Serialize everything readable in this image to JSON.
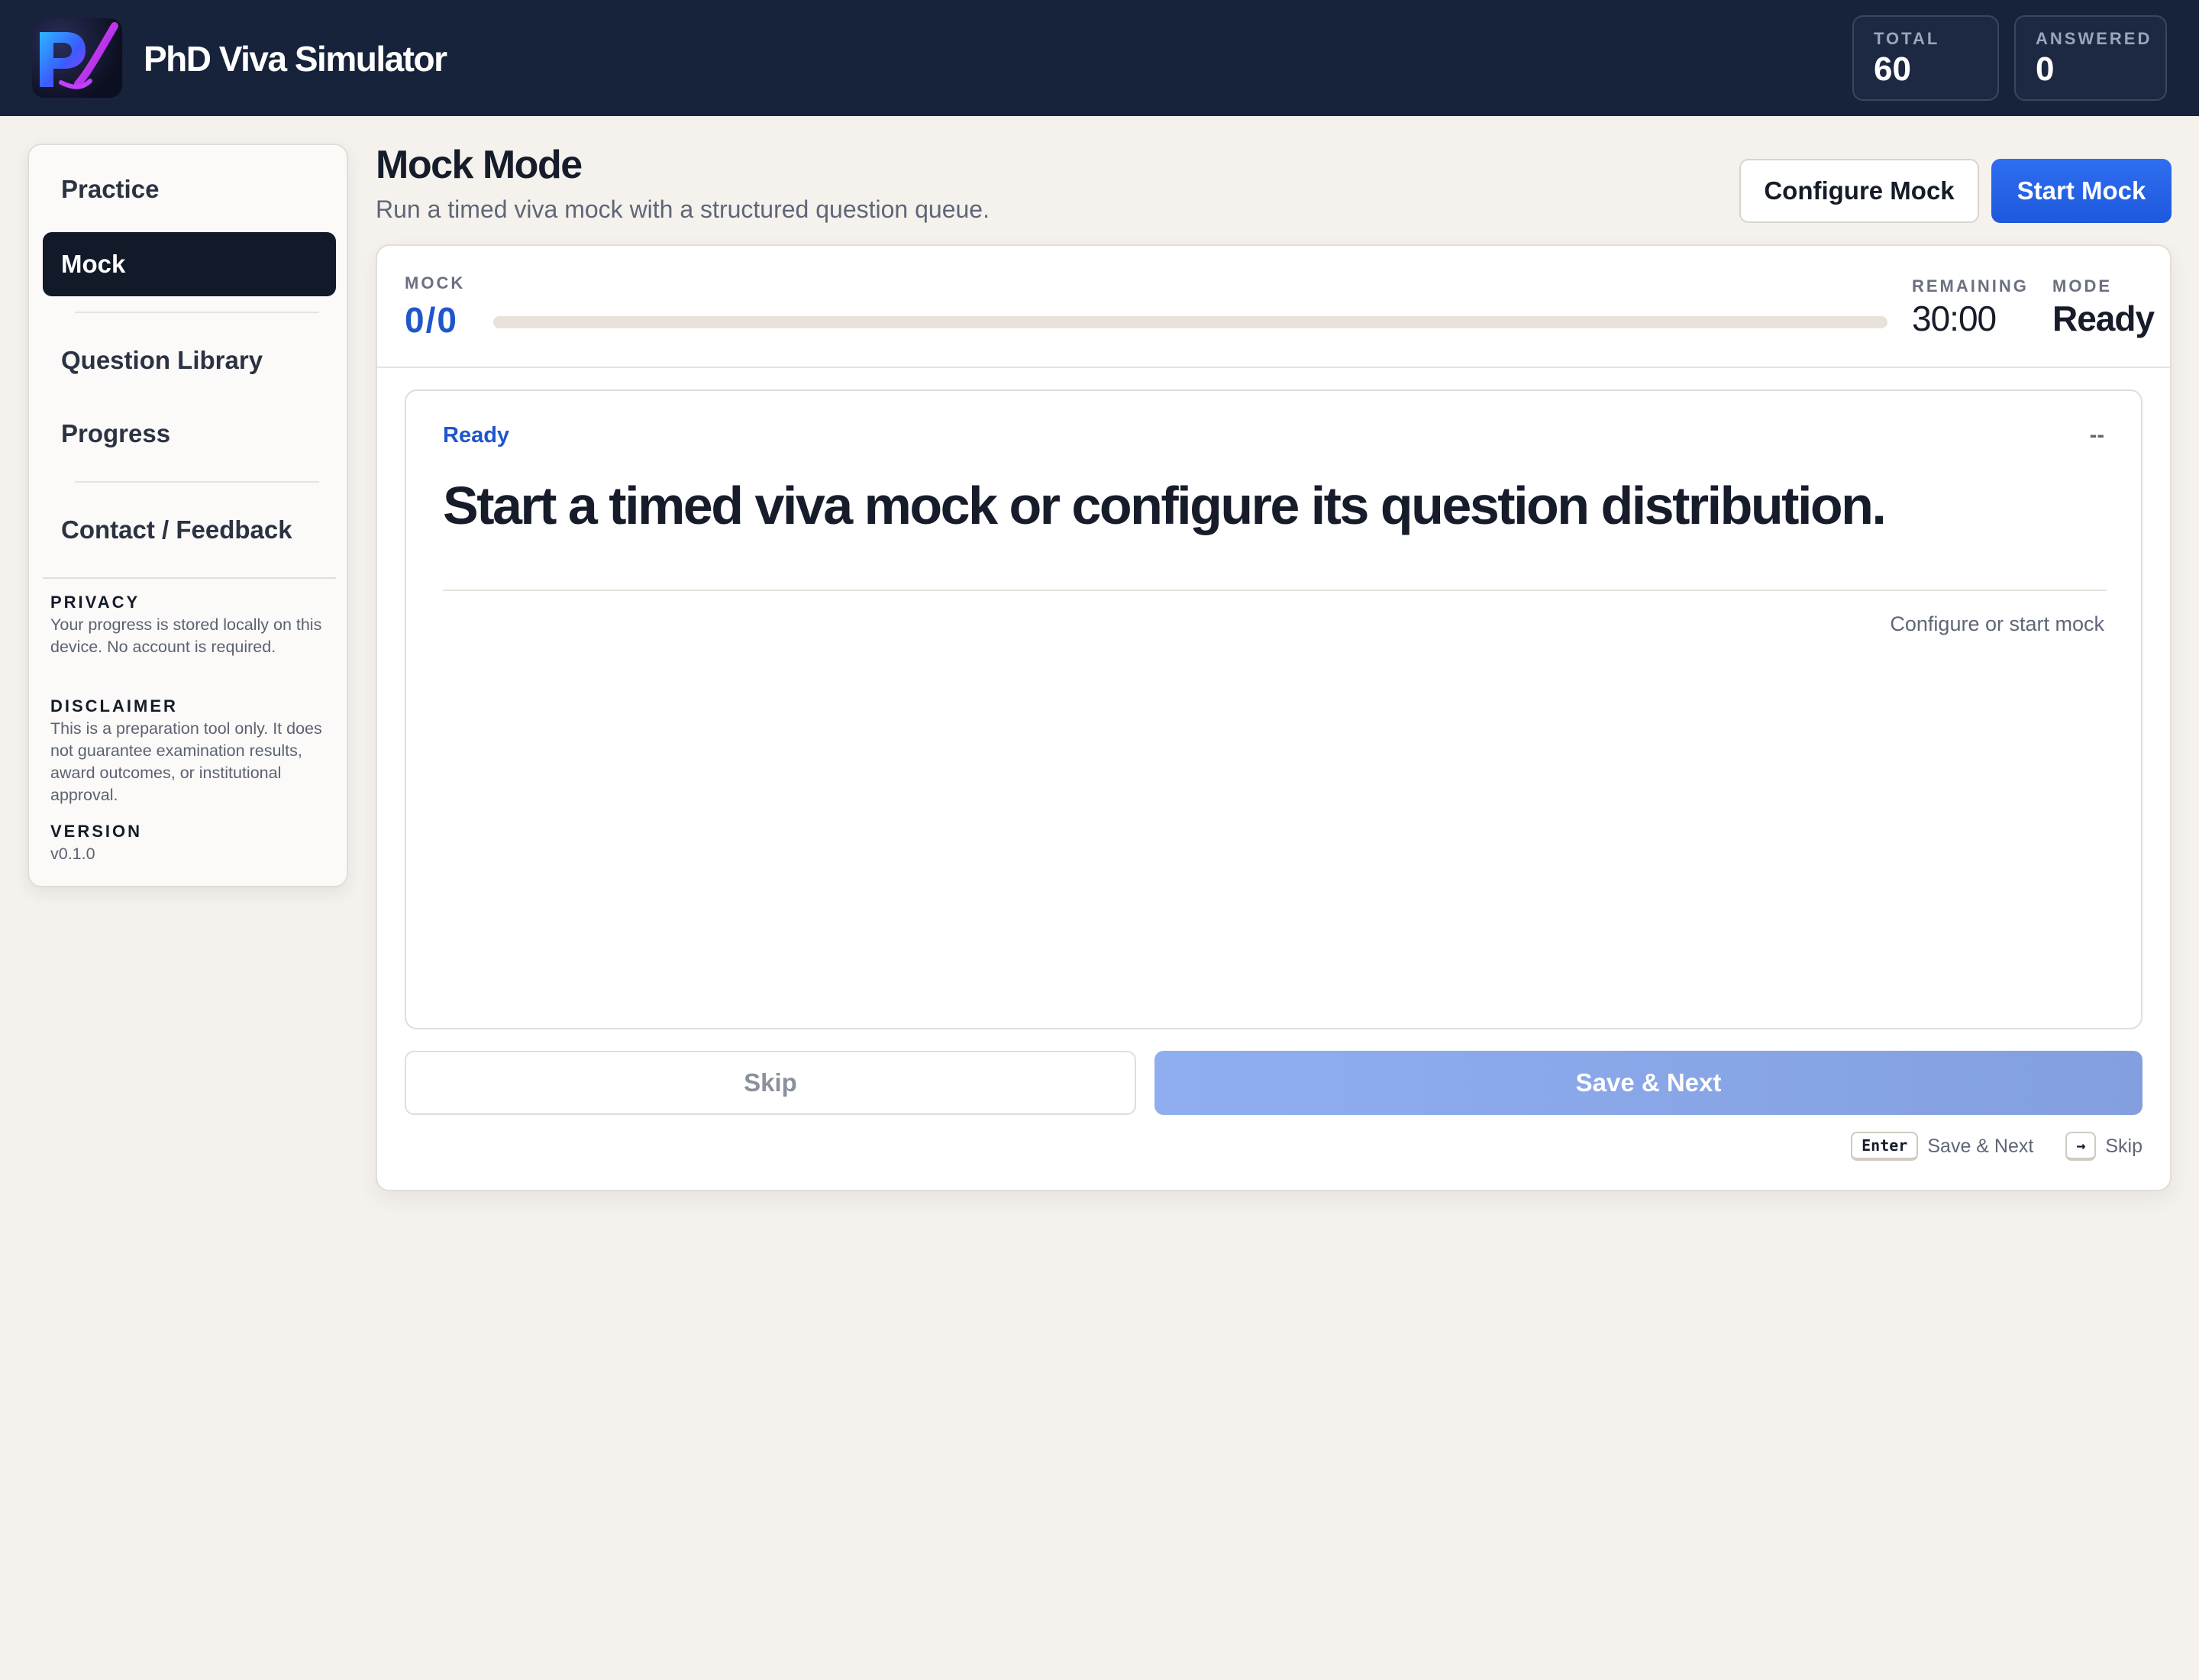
{
  "app": {
    "title": "PhD Viva Simulator",
    "logo": "PV-logo"
  },
  "stats": {
    "total_label": "TOTAL",
    "total_value": "60",
    "answered_label": "ANSWERED",
    "answered_value": "0"
  },
  "sidebar": {
    "items": [
      {
        "label": "Practice"
      },
      {
        "label": "Mock",
        "active": true
      },
      {
        "label": "Question Library"
      },
      {
        "label": "Progress"
      },
      {
        "label": "Contact / Feedback"
      }
    ],
    "privacy_label": "PRIVACY",
    "privacy_text": "Your progress is stored locally on this device. No account is required.",
    "disclaimer_label": "DISCLAIMER",
    "disclaimer_text": "This is a preparation tool only. It does not guarantee examination results, award outcomes, or institutional approval.",
    "version_label": "VERSION",
    "version_value": "v0.1.0"
  },
  "page": {
    "title": "Mock Mode",
    "subtitle": "Run a timed viva mock with a structured question queue.",
    "configure_label": "Configure Mock",
    "start_label": "Start Mock"
  },
  "mock": {
    "label": "MOCK",
    "count": "0/0",
    "progress_fraction": 0,
    "remaining_label": "REMAINING",
    "remaining_value": "30:00",
    "mode_label": "MODE",
    "mode_value": "Ready"
  },
  "question": {
    "status": "Ready",
    "meta": "--",
    "text": "Start a timed viva mock or configure its question distribution.",
    "hint": "Configure or start mock"
  },
  "actions": {
    "skip_label": "Skip",
    "save_label": "Save & Next"
  },
  "shortcuts": {
    "save_key": "Enter",
    "save_label": "Save & Next",
    "skip_key": "→",
    "skip_label": "Skip"
  },
  "colors": {
    "header_bg": "#17233b",
    "accent": "#1e56cc",
    "active_nav": "#121a29",
    "page_bg": "#f5f2ee"
  }
}
